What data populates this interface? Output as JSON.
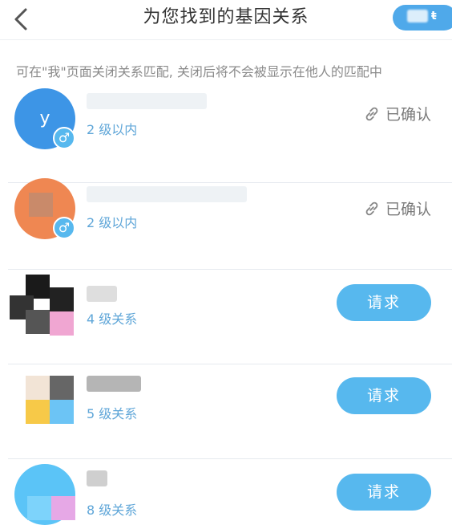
{
  "header": {
    "title": "为您找到的基因关系",
    "back_icon": "chevron-left-icon",
    "right_pill_glyph": "ŧ"
  },
  "notice": "可在\"我\"页面关闭关系匹配, 关闭后将不会被显示在他人的匹配中",
  "colors": {
    "accent": "#57b8ee",
    "level_text": "#5fa6d8",
    "notice_text": "#8a8a8a",
    "divider": "#e6eaef"
  },
  "matches": [
    {
      "avatar_letter": "y",
      "avatar_color": "#3d95e6",
      "gender_symbol": "♂",
      "level": "2 级以内",
      "status": "已确认",
      "action": null
    },
    {
      "avatar_letter": "",
      "avatar_color": "#ef8752",
      "gender_symbol": "♂",
      "level": "2 级以内",
      "status": "已确认",
      "action": null
    },
    {
      "avatar_letter": "",
      "avatar_color": "",
      "gender_symbol": "",
      "level": "4 级关系",
      "status": "",
      "action": "请求"
    },
    {
      "avatar_letter": "",
      "avatar_color": "",
      "gender_symbol": "",
      "level": "5 级关系",
      "status": "",
      "action": "请求"
    },
    {
      "avatar_letter": "",
      "avatar_color": "",
      "gender_symbol": "",
      "level": "8 级关系",
      "status": "",
      "action": "请求"
    }
  ]
}
